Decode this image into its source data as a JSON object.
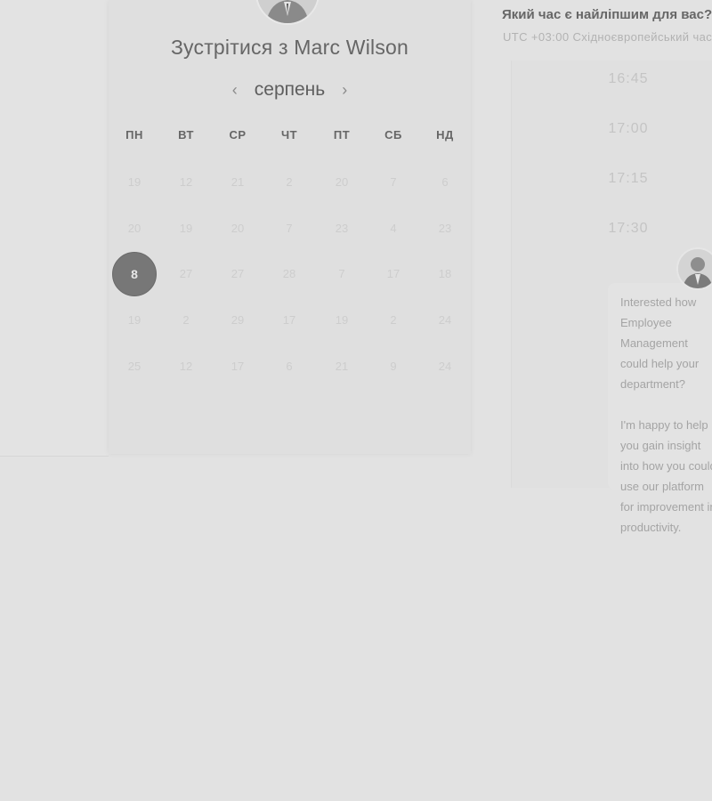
{
  "calendar": {
    "title": "Зустрітися з Marc Wilson",
    "month": "серпень",
    "prev_icon": "chevron-left-icon",
    "next_icon": "chevron-right-icon",
    "weekdays": [
      "ПН",
      "ВТ",
      "СР",
      "ЧТ",
      "ПТ",
      "СБ",
      "НД"
    ],
    "weeks": [
      [
        "19",
        "12",
        "21",
        "2",
        "20",
        "7",
        "6"
      ],
      [
        "20",
        "19",
        "20",
        "7",
        "23",
        "4",
        "23"
      ],
      [
        "8",
        "27",
        "27",
        "28",
        "7",
        "17",
        "18"
      ],
      [
        "19",
        "2",
        "29",
        "17",
        "19",
        "2",
        "24"
      ],
      [
        "25",
        "12",
        "17",
        "6",
        "21",
        "9",
        "24"
      ]
    ],
    "selected_day": "8"
  },
  "time_picker": {
    "question": "Який час є найліпшим для вас?",
    "timezone": "UTC +03:00 Східноєвропейський час",
    "slots": [
      "16:45",
      "17:00",
      "17:15",
      "17:30"
    ]
  },
  "host": {
    "message": "Interested how Employee Management could help your department?\n\nI'm happy to help you gain insight into how you could use our platform for improvement in productivity."
  },
  "colors": {
    "background": "#e2e2e2",
    "selected_day": "#777777"
  }
}
